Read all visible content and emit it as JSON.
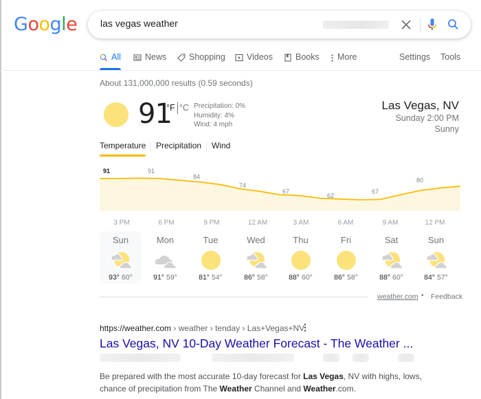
{
  "logo": {
    "letters": [
      "G",
      "o",
      "o",
      "g",
      "l",
      "e"
    ]
  },
  "search": {
    "query": "las vegas weather",
    "clear_label": "×"
  },
  "tabs": [
    {
      "label": "All",
      "icon": "search-icon",
      "active": true
    },
    {
      "label": "News",
      "icon": "news-icon"
    },
    {
      "label": "Shopping",
      "icon": "tag-icon"
    },
    {
      "label": "Videos",
      "icon": "play-icon"
    },
    {
      "label": "Books",
      "icon": "book-icon"
    },
    {
      "label": "More",
      "icon": "more-vert-icon"
    }
  ],
  "tools": {
    "settings": "Settings",
    "tools": "Tools"
  },
  "result_stats": "About 131,000,000 results (0.59 seconds)",
  "weather": {
    "current_temp": "91",
    "unit_f": "°F",
    "unit_c": "°C",
    "precipitation": "Precipitation: 0%",
    "humidity": "Humidity: 4%",
    "wind": "Wind: 4 mph",
    "location": "Las Vegas, NV",
    "time": "Sunday 2:00 PM",
    "condition": "Sunny",
    "colors": {
      "sun": "#fbe27a",
      "line": "#fbbc04",
      "fill": "#fef7e0",
      "cloud": "#d2d2d2"
    },
    "tabs": [
      {
        "label": "Temperature",
        "active": true
      },
      {
        "label": "Precipitation"
      },
      {
        "label": "Wind"
      }
    ],
    "days": [
      {
        "name": "Sun",
        "icon": "partly-cloudy",
        "hi": "93°",
        "lo": "60°",
        "selected": true
      },
      {
        "name": "Mon",
        "icon": "cloudy",
        "hi": "91°",
        "lo": "59°"
      },
      {
        "name": "Tue",
        "icon": "sunny",
        "hi": "81°",
        "lo": "54°"
      },
      {
        "name": "Wed",
        "icon": "partly-cloudy",
        "hi": "86°",
        "lo": "58°"
      },
      {
        "name": "Thu",
        "icon": "sunny",
        "hi": "88°",
        "lo": "60°"
      },
      {
        "name": "Fri",
        "icon": "sunny",
        "hi": "86°",
        "lo": "58°"
      },
      {
        "name": "Sat",
        "icon": "partly-cloudy",
        "hi": "88°",
        "lo": "60°"
      },
      {
        "name": "Sun",
        "icon": "partly-cloudy",
        "hi": "84°",
        "lo": "57°"
      }
    ],
    "source": "weather.com",
    "dot": "•",
    "feedback": "Feedback"
  },
  "chart_data": {
    "type": "area",
    "title": "Temperature",
    "xlabel": "",
    "ylabel": "",
    "categories": [
      "3 PM",
      "6 PM",
      "9 PM",
      "12 AM",
      "3 AM",
      "6 AM",
      "9 AM",
      "12 PM"
    ],
    "labels": [
      91,
      91,
      84,
      74,
      67,
      62,
      67,
      80
    ],
    "series": [
      {
        "name": "Temperature (°F)",
        "x_hours": [
          0,
          1.5,
          3,
          4.5,
          6,
          7.5,
          9,
          10.5,
          12,
          13.5,
          15,
          16.5,
          18,
          19.5,
          21,
          22.5,
          24
        ],
        "values": [
          91,
          91,
          91.5,
          91,
          89,
          87,
          84,
          79,
          76,
          72,
          71,
          68,
          67,
          66,
          66.5,
          72,
          77,
          80,
          82
        ]
      }
    ],
    "point_values": [
      91,
      91,
      91.5,
      91,
      89,
      87,
      84,
      79,
      76,
      72,
      71,
      68,
      67,
      66,
      66.5,
      72,
      77,
      80,
      82
    ],
    "ylim": [
      40,
      100
    ],
    "grid": false,
    "legend": "none"
  },
  "result": {
    "url_host": "https://weather.com",
    "url_path": " › weather › tenday › Las+Vegas+NV",
    "menu_label": "⋮",
    "title": "Las Vegas, NV 10-Day Weather Forecast - The Weather ...",
    "snippet_parts": [
      {
        "t": "Be prepared with the most accurate 10-day forecast for "
      },
      {
        "t": "Las Vegas",
        "b": true
      },
      {
        "t": ", NV with highs, lows, chance of precipitation from The "
      },
      {
        "t": "Weather",
        "b": true
      },
      {
        "t": " Channel and "
      },
      {
        "t": "Weather",
        "b": true
      },
      {
        "t": ".com."
      }
    ]
  }
}
